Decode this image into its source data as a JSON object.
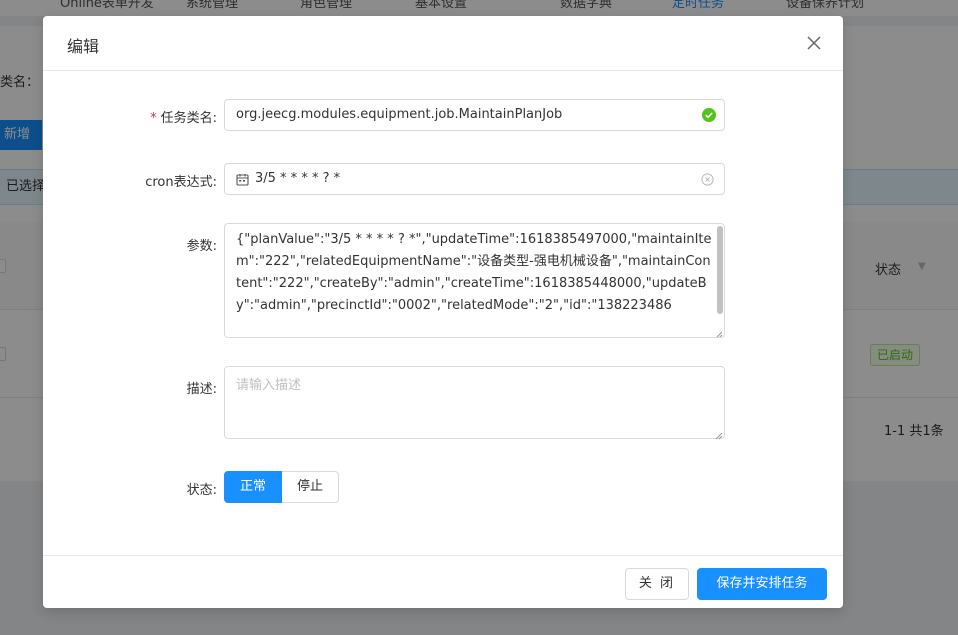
{
  "background": {
    "nav_items": [
      {
        "label": "Online表单开发",
        "active": false
      },
      {
        "label": "系统管理",
        "active": false
      },
      {
        "label": "角色管理",
        "active": false
      },
      {
        "label": "基本设置",
        "active": false
      },
      {
        "label": "数据字典",
        "active": false
      },
      {
        "label": "定时任务",
        "active": true
      },
      {
        "label": "设备保养计划",
        "active": false
      }
    ],
    "filter_label": "类名：",
    "new_button": "新增",
    "selected_text": "已选择",
    "status_header": "状态",
    "status_tag": "已启动",
    "pagination": "1-1 共1条"
  },
  "modal": {
    "title": "编辑",
    "fields": {
      "task_class": {
        "label": "任务类名:",
        "value": "org.jeecg.modules.equipment.job.MaintainPlanJob"
      },
      "cron": {
        "label": "cron表达式:",
        "value": "3/5 * * * * ? *"
      },
      "params": {
        "label": "参数:",
        "value": "{\"planValue\":\"3/5 * * * * ? *\",\"updateTime\":1618385497000,\"maintainItem\":\"222\",\"relatedEquipmentName\":\"设备类型-强电机械设备\",\"maintainContent\":\"222\",\"createBy\":\"admin\",\"createTime\":1618385448000,\"updateBy\":\"admin\",\"precinctId\":\"0002\",\"relatedMode\":\"2\",\"id\":\"138223486"
      },
      "description": {
        "label": "描述:",
        "placeholder": "请输入描述"
      },
      "status": {
        "label": "状态:",
        "options": [
          "正常",
          "停止"
        ],
        "selected": "正常"
      }
    },
    "footer": {
      "close_label": "关 闭",
      "save_label": "保存并安排任务"
    }
  },
  "colors": {
    "primary": "#1890ff",
    "success": "#52c41a",
    "required": "#f5222d"
  }
}
